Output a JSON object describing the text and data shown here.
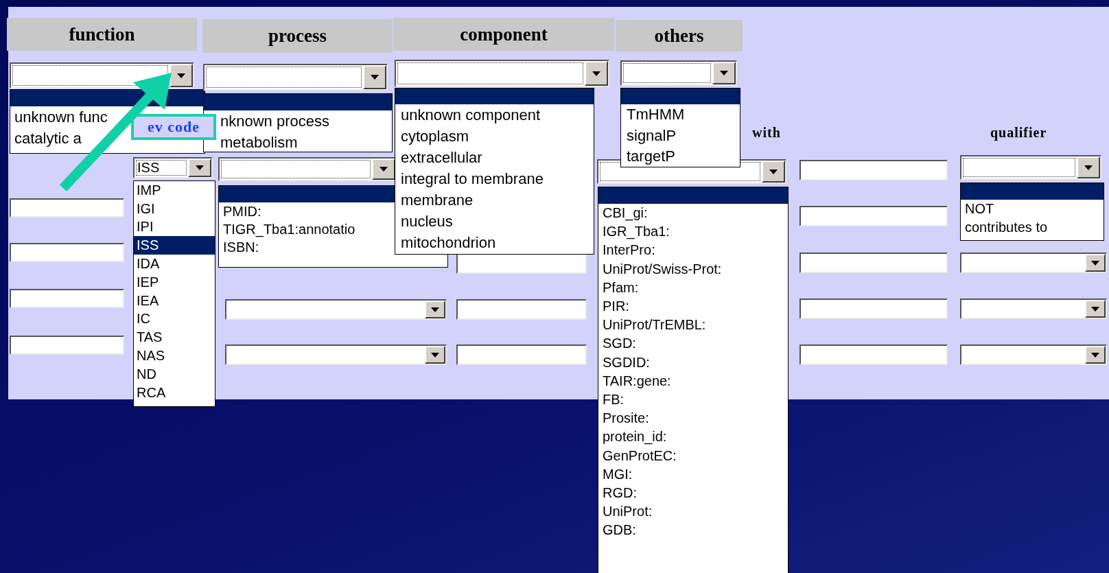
{
  "column_headers": [
    {
      "label": "function"
    },
    {
      "label": "process"
    },
    {
      "label": "component"
    },
    {
      "label": "others"
    }
  ],
  "function_select": {
    "options": [
      "unknown func",
      "catalytic a"
    ]
  },
  "process_select": {
    "options": [
      "nknown process",
      "metabolism"
    ]
  },
  "component_select": {
    "options": [
      "unknown component",
      "cytoplasm",
      "extracellular",
      "integral to membrane",
      "membrane",
      "nucleus",
      "mitochondrion"
    ]
  },
  "others_select": {
    "options": [
      "TmHMM",
      "signalP",
      "targetP"
    ]
  },
  "callout": {
    "label": "ev code"
  },
  "evidence_select": {
    "value": "ISS",
    "options": [
      {
        "label": "IMP",
        "selected": false
      },
      {
        "label": "IGI",
        "selected": false
      },
      {
        "label": "IPI",
        "selected": false
      },
      {
        "label": "ISS",
        "selected": true
      },
      {
        "label": "IDA",
        "selected": false
      },
      {
        "label": "IEP",
        "selected": false
      },
      {
        "label": "IEA",
        "selected": false
      },
      {
        "label": "IC",
        "selected": false
      },
      {
        "label": "TAS",
        "selected": false
      },
      {
        "label": "NAS",
        "selected": false
      },
      {
        "label": "ND",
        "selected": false
      },
      {
        "label": "RCA",
        "selected": false
      }
    ]
  },
  "reference_select": {
    "options": [
      "PMID:",
      "TIGR_Tba1:annotatio",
      "ISBN:"
    ]
  },
  "with_label": "with",
  "qualifier_label": "qualifier",
  "with_select": {
    "options": [
      "CBI_gi:",
      "IGR_Tba1:",
      "InterPro:",
      "UniProt/Swiss-Prot:",
      "Pfam:",
      "PIR:",
      "UniProt/TrEMBL:",
      "SGD:",
      "SGDID:",
      "TAIR:gene:",
      "FB:",
      "Prosite:",
      "protein_id:",
      "GenProtEC:",
      "MGI:",
      "RGD:",
      "UniProt:",
      "GDB:"
    ]
  },
  "qualifier_select": {
    "options": [
      "NOT",
      "contributes to"
    ]
  }
}
